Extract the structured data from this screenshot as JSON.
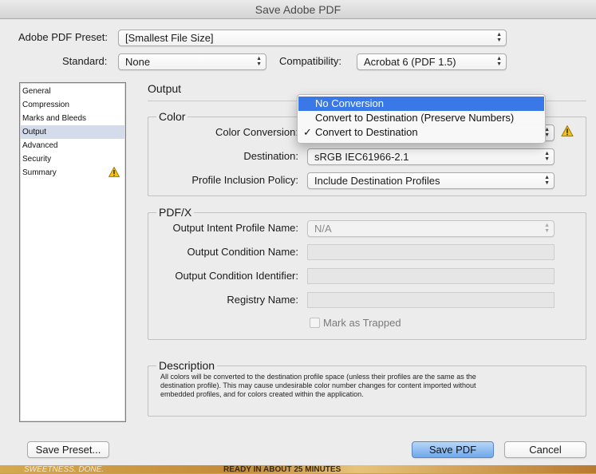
{
  "window": {
    "title": "Save Adobe PDF"
  },
  "top": {
    "preset_label": "Adobe PDF Preset:",
    "preset_value": "[Smallest File Size]",
    "standard_label": "Standard:",
    "standard_value": "None",
    "compat_label": "Compatibility:",
    "compat_value": "Acrobat 6 (PDF 1.5)"
  },
  "sidebar": {
    "items": [
      {
        "label": "General"
      },
      {
        "label": "Compression"
      },
      {
        "label": "Marks and Bleeds"
      },
      {
        "label": "Output"
      },
      {
        "label": "Advanced"
      },
      {
        "label": "Security"
      },
      {
        "label": "Summary"
      }
    ],
    "selected": "Output"
  },
  "output": {
    "heading": "Output",
    "color": {
      "title": "Color",
      "conversion_label": "Color Conversion:",
      "destination_label": "Destination:",
      "destination_value": "sRGB IEC61966-2.1",
      "policy_label": "Profile Inclusion Policy:",
      "policy_value": "Include Destination Profiles"
    },
    "pdfx": {
      "title": "PDF/X",
      "intent_label": "Output Intent Profile Name:",
      "intent_value": "N/A",
      "condition_name_label": "Output Condition Name:",
      "condition_id_label": "Output Condition Identifier:",
      "registry_label": "Registry Name:",
      "trapped_label": "Mark as Trapped"
    },
    "description": {
      "title": "Description",
      "text": "All colors will be converted to the destination profile space (unless their profiles are the same as the destination profile). This may cause undesirable color number changes for content imported without embedded profiles, and for colors created within the application."
    }
  },
  "dropdown_menu": {
    "items": [
      {
        "label": "No Conversion",
        "highlighted": true,
        "checked": false
      },
      {
        "label": "Convert to Destination (Preserve Numbers)",
        "highlighted": false,
        "checked": false
      },
      {
        "label": "Convert to Destination",
        "highlighted": false,
        "checked": true
      }
    ],
    "check_glyph": "✓"
  },
  "buttons": {
    "save_preset": "Save Preset...",
    "save_pdf": "Save PDF",
    "cancel": "Cancel"
  },
  "background": {
    "text_left": "SWEETNESS. DONE.",
    "text_mid": "READY IN ABOUT 25 MINUTES"
  },
  "colors": {
    "highlight": "#3b78e7",
    "primary_button": "#6fa8ec",
    "sidebar_selection": "#d4dcec",
    "warning": "#f2c018"
  }
}
